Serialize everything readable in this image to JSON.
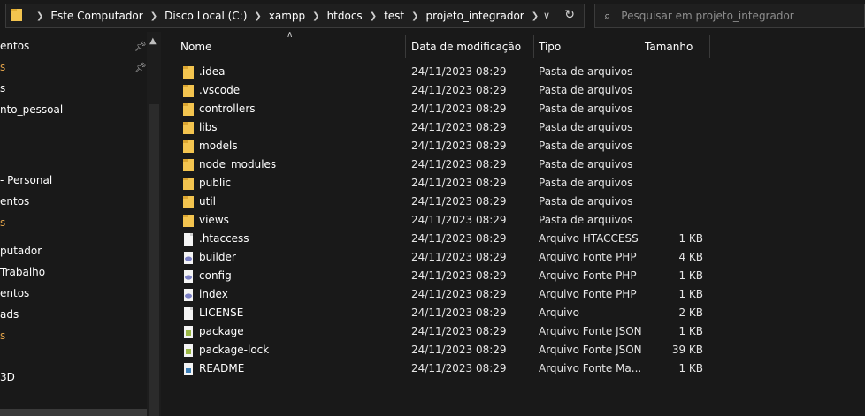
{
  "address_bar": {
    "breadcrumbs": [
      "Este Computador",
      "Disco Local (C:)",
      "xampp",
      "htdocs",
      "test",
      "projeto_integrador"
    ]
  },
  "search": {
    "placeholder": "Pesquisar em projeto_integrador"
  },
  "nav_pane": {
    "items": [
      {
        "label": "entos",
        "pinned": true,
        "orange": false
      },
      {
        "label": "s",
        "pinned": true,
        "orange": true
      },
      {
        "label": "s",
        "pinned": false,
        "orange": false
      },
      {
        "label": "nto_pessoal",
        "pinned": false,
        "orange": false
      },
      {
        "label": "- Personal",
        "pinned": false,
        "orange": false
      },
      {
        "label": "entos",
        "pinned": false,
        "orange": false
      },
      {
        "label": "s",
        "pinned": false,
        "orange": true
      },
      {
        "label": "putador",
        "pinned": false,
        "orange": false
      },
      {
        "label": "Trabalho",
        "pinned": false,
        "orange": false
      },
      {
        "label": "entos",
        "pinned": false,
        "orange": false
      },
      {
        "label": "ads",
        "pinned": false,
        "orange": false
      },
      {
        "label": "s",
        "pinned": false,
        "orange": true
      },
      {
        "label": "3D",
        "pinned": false,
        "orange": false
      }
    ]
  },
  "columns": {
    "name": "Nome",
    "date": "Data de modificação",
    "type": "Tipo",
    "size": "Tamanho"
  },
  "files": [
    {
      "name": ".idea",
      "date": "24/11/2023 08:29",
      "type": "Pasta de arquivos",
      "size": "",
      "icon": "folder-icon"
    },
    {
      "name": ".vscode",
      "date": "24/11/2023 08:29",
      "type": "Pasta de arquivos",
      "size": "",
      "icon": "folder-icon"
    },
    {
      "name": "controllers",
      "date": "24/11/2023 08:29",
      "type": "Pasta de arquivos",
      "size": "",
      "icon": "folder-icon"
    },
    {
      "name": "libs",
      "date": "24/11/2023 08:29",
      "type": "Pasta de arquivos",
      "size": "",
      "icon": "folder-icon"
    },
    {
      "name": "models",
      "date": "24/11/2023 08:29",
      "type": "Pasta de arquivos",
      "size": "",
      "icon": "folder-icon"
    },
    {
      "name": "node_modules",
      "date": "24/11/2023 08:29",
      "type": "Pasta de arquivos",
      "size": "",
      "icon": "folder-icon"
    },
    {
      "name": "public",
      "date": "24/11/2023 08:29",
      "type": "Pasta de arquivos",
      "size": "",
      "icon": "folder-icon"
    },
    {
      "name": "util",
      "date": "24/11/2023 08:29",
      "type": "Pasta de arquivos",
      "size": "",
      "icon": "folder-icon"
    },
    {
      "name": "views",
      "date": "24/11/2023 08:29",
      "type": "Pasta de arquivos",
      "size": "",
      "icon": "folder-icon"
    },
    {
      "name": ".htaccess",
      "date": "24/11/2023 08:29",
      "type": "Arquivo HTACCESS",
      "size": "1 KB",
      "icon": "file-icon"
    },
    {
      "name": "builder",
      "date": "24/11/2023 08:29",
      "type": "Arquivo Fonte PHP",
      "size": "4 KB",
      "icon": "php-file-icon"
    },
    {
      "name": "config",
      "date": "24/11/2023 08:29",
      "type": "Arquivo Fonte PHP",
      "size": "1 KB",
      "icon": "php-file-icon"
    },
    {
      "name": "index",
      "date": "24/11/2023 08:29",
      "type": "Arquivo Fonte PHP",
      "size": "1 KB",
      "icon": "php-file-icon"
    },
    {
      "name": "LICENSE",
      "date": "24/11/2023 08:29",
      "type": "Arquivo",
      "size": "2 KB",
      "icon": "file-icon"
    },
    {
      "name": "package",
      "date": "24/11/2023 08:29",
      "type": "Arquivo Fonte JSON",
      "size": "1 KB",
      "icon": "json-file-icon"
    },
    {
      "name": "package-lock",
      "date": "24/11/2023 08:29",
      "type": "Arquivo Fonte JSON",
      "size": "39 KB",
      "icon": "json-file-icon"
    },
    {
      "name": "README",
      "date": "24/11/2023 08:29",
      "type": "Arquivo Fonte Ma...",
      "size": "1 KB",
      "icon": "markdown-file-icon"
    }
  ]
}
